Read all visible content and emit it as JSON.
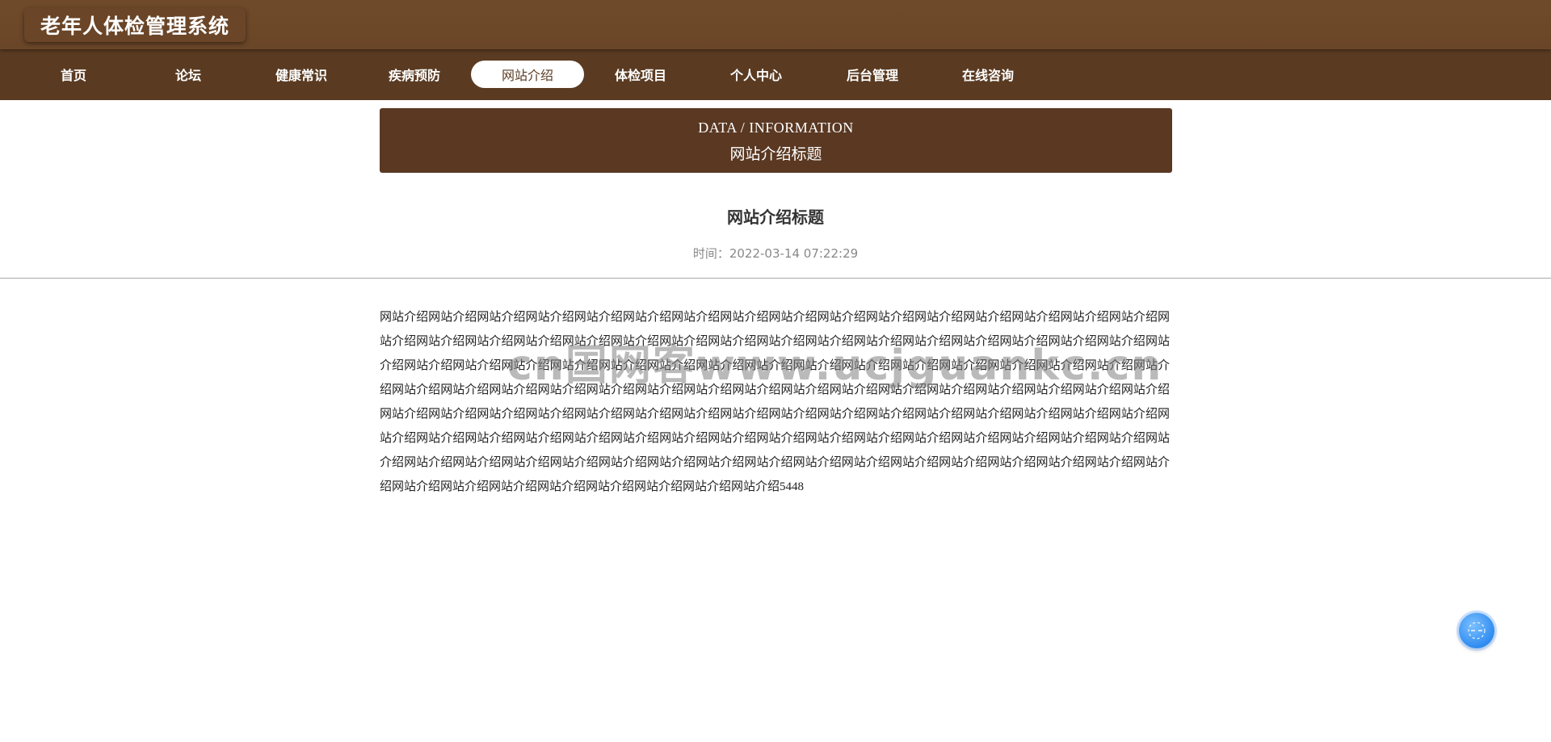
{
  "header": {
    "title": "老年人体检管理系统"
  },
  "nav": {
    "items": [
      {
        "label": "首页",
        "active": false
      },
      {
        "label": "论坛",
        "active": false
      },
      {
        "label": "健康常识",
        "active": false
      },
      {
        "label": "疾病预防",
        "active": false
      },
      {
        "label": "网站介绍",
        "active": true
      },
      {
        "label": "体检项目",
        "active": false
      },
      {
        "label": "个人中心",
        "active": false
      },
      {
        "label": "后台管理",
        "active": false
      },
      {
        "label": "在线咨询",
        "active": false
      }
    ]
  },
  "banner": {
    "english": "DATA / INFORMATION",
    "chinese": "网站介绍标题"
  },
  "article": {
    "title": "网站介绍标题",
    "time": "时间：2022-03-14 07:22:29",
    "body": "网站介绍网站介绍网站介绍网站介绍网站介绍网站介绍网站介绍网站介绍网站介绍网站介绍网站介绍网站介绍网站介绍网站介绍网站介绍网站介绍网站介绍网站介绍网站介绍网站介绍网站介绍网站介绍网站介绍网站介绍网站介绍网站介绍网站介绍网站介绍网站介绍网站介绍网站介绍网站介绍网站介绍网站介绍网站介绍网站介绍网站介绍网站介绍网站介绍网站介绍网站介绍网站介绍网站介绍网站介绍网站介绍网站介绍网站介绍网站介绍网站介绍网站介绍网站介绍网站介绍网站介绍网站介绍网站介绍网站介绍网站介绍网站介绍网站介绍网站介绍网站介绍网站介绍网站介绍网站介绍网站介绍网站介绍网站介绍网站介绍网站介绍网站介绍网站介绍网站介绍网站介绍网站介绍网站介绍网站介绍网站介绍网站介绍网站介绍网站介绍网站介绍网站介绍网站介绍网站介绍网站介绍网站介绍网站介绍网站介绍网站介绍网站介绍网站介绍网站介绍网站介绍网站介绍网站介绍网站介绍网站介绍网站介绍网站介绍网站介绍网站介绍网站介绍网站介绍网站介绍网站介绍网站介绍网站介绍网站介绍网站介绍网站介绍网站介绍网站介绍网站介绍网站介绍网站介绍网站介绍网站介绍网站介绍网站介绍网站介绍网站介绍网站介绍5448"
  },
  "watermark": {
    "text": "cn国网客www.ucjguankc.cn"
  },
  "float_button": {
    "icon": "chat-icon"
  },
  "colors": {
    "header_bg": "#6f4a2a",
    "nav_bg": "#5a3b22",
    "banner_bg": "#5a3822",
    "float_button": "#2f8cf0"
  }
}
